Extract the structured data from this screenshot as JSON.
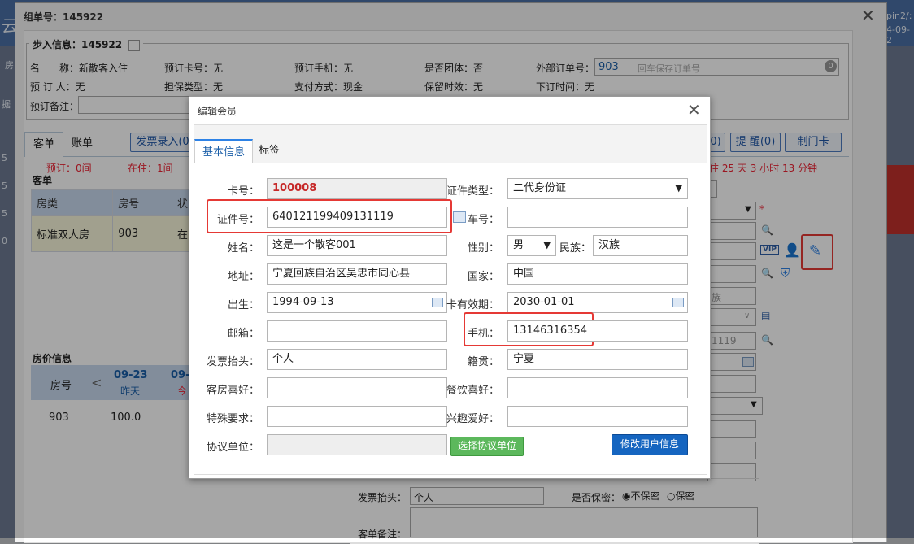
{
  "background": {
    "left_chars": [
      "房",
      "据",
      "5",
      "5",
      "5",
      "0"
    ],
    "right_lines": [
      "pin2/:",
      "4-09-2"
    ]
  },
  "window": {
    "title": "组单号：145922"
  },
  "booking": {
    "legend": "步入信息：145922",
    "row1": [
      "名　　称：新散客入住",
      "预订卡号：无",
      "预订手机：无",
      "是否团体：否",
      "外部订单号："
    ],
    "external_order_value": "903",
    "external_order_placeholder": "回车保存订单号",
    "badge_count": "0",
    "row2": [
      "预 订 人：无",
      "担保类型：无",
      "支付方式：现金",
      "保留时效：无",
      "下订时间：无"
    ],
    "remark_label": "预订备注："
  },
  "tabs": {
    "items": [
      "客单",
      "账单"
    ],
    "invoice_button": "发票录入(0",
    "right_buttons": [
      "0)",
      "提 醒(0)",
      "制门卡"
    ]
  },
  "status": {
    "reserved": "预订：0间",
    "in_house": "在住：1间",
    "stay_time": "住 25 天 3 小时 13 分钟"
  },
  "guest_table": {
    "legend": "客单",
    "headers": [
      "房类",
      "房号",
      "状"
    ],
    "row": [
      "标准双人房",
      "903",
      "在"
    ]
  },
  "price_table": {
    "legend": "房价信息",
    "room_header": "房号",
    "nav_prev": "<",
    "col1_date": "09-23",
    "col1_day": "昨天",
    "col2_date": "09-",
    "col2_day": "今",
    "room": "903",
    "price": "100.0"
  },
  "right_panel": {
    "nation_fragment": "族",
    "id_fragment": "1119",
    "vip_label": "VIP"
  },
  "bottom_form": {
    "invoice_label": "发票抬头：",
    "invoice_value": "个人",
    "secret_label": "是否保密：",
    "secret_options": [
      "不保密",
      "保密"
    ],
    "remark_label": "客单备注："
  },
  "modal": {
    "title": "编辑会员",
    "tabs": [
      "基本信息",
      "标签"
    ],
    "fields": {
      "card_no_label": "卡号：",
      "card_no_value": "100008",
      "id_type_label": "证件类型：",
      "id_type_value": "二代身份证",
      "id_no_label": "证件号：",
      "id_no_value": "640121199409131119",
      "car_label": "车号：",
      "name_label": "姓名：",
      "name_value": "这是一个散客001",
      "gender_label": "性别：",
      "gender_value": "男",
      "ethnic_label": "民族：",
      "ethnic_value": "汉族",
      "address_label": "地址：",
      "address_value": "宁夏回族自治区吴忠市同心县",
      "country_label": "国家：",
      "country_value": "中国",
      "birth_label": "出生：",
      "birth_value": "1994-09-13",
      "expire_label": "卡有效期：",
      "expire_value": "2030-01-01",
      "email_label": "邮箱：",
      "phone_label": "手机：",
      "phone_value": "13146316354",
      "invoice_label": "发票抬头：",
      "invoice_value": "个人",
      "native_label": "籍贯：",
      "native_value": "宁夏",
      "room_pref_label": "客房喜好：",
      "food_pref_label": "餐饮喜好：",
      "special_label": "特殊要求：",
      "hobby_label": "兴趣爱好：",
      "agreement_label": "协议单位："
    },
    "select_agreement_button": "选择协议单位",
    "update_button": "修改用户信息"
  }
}
